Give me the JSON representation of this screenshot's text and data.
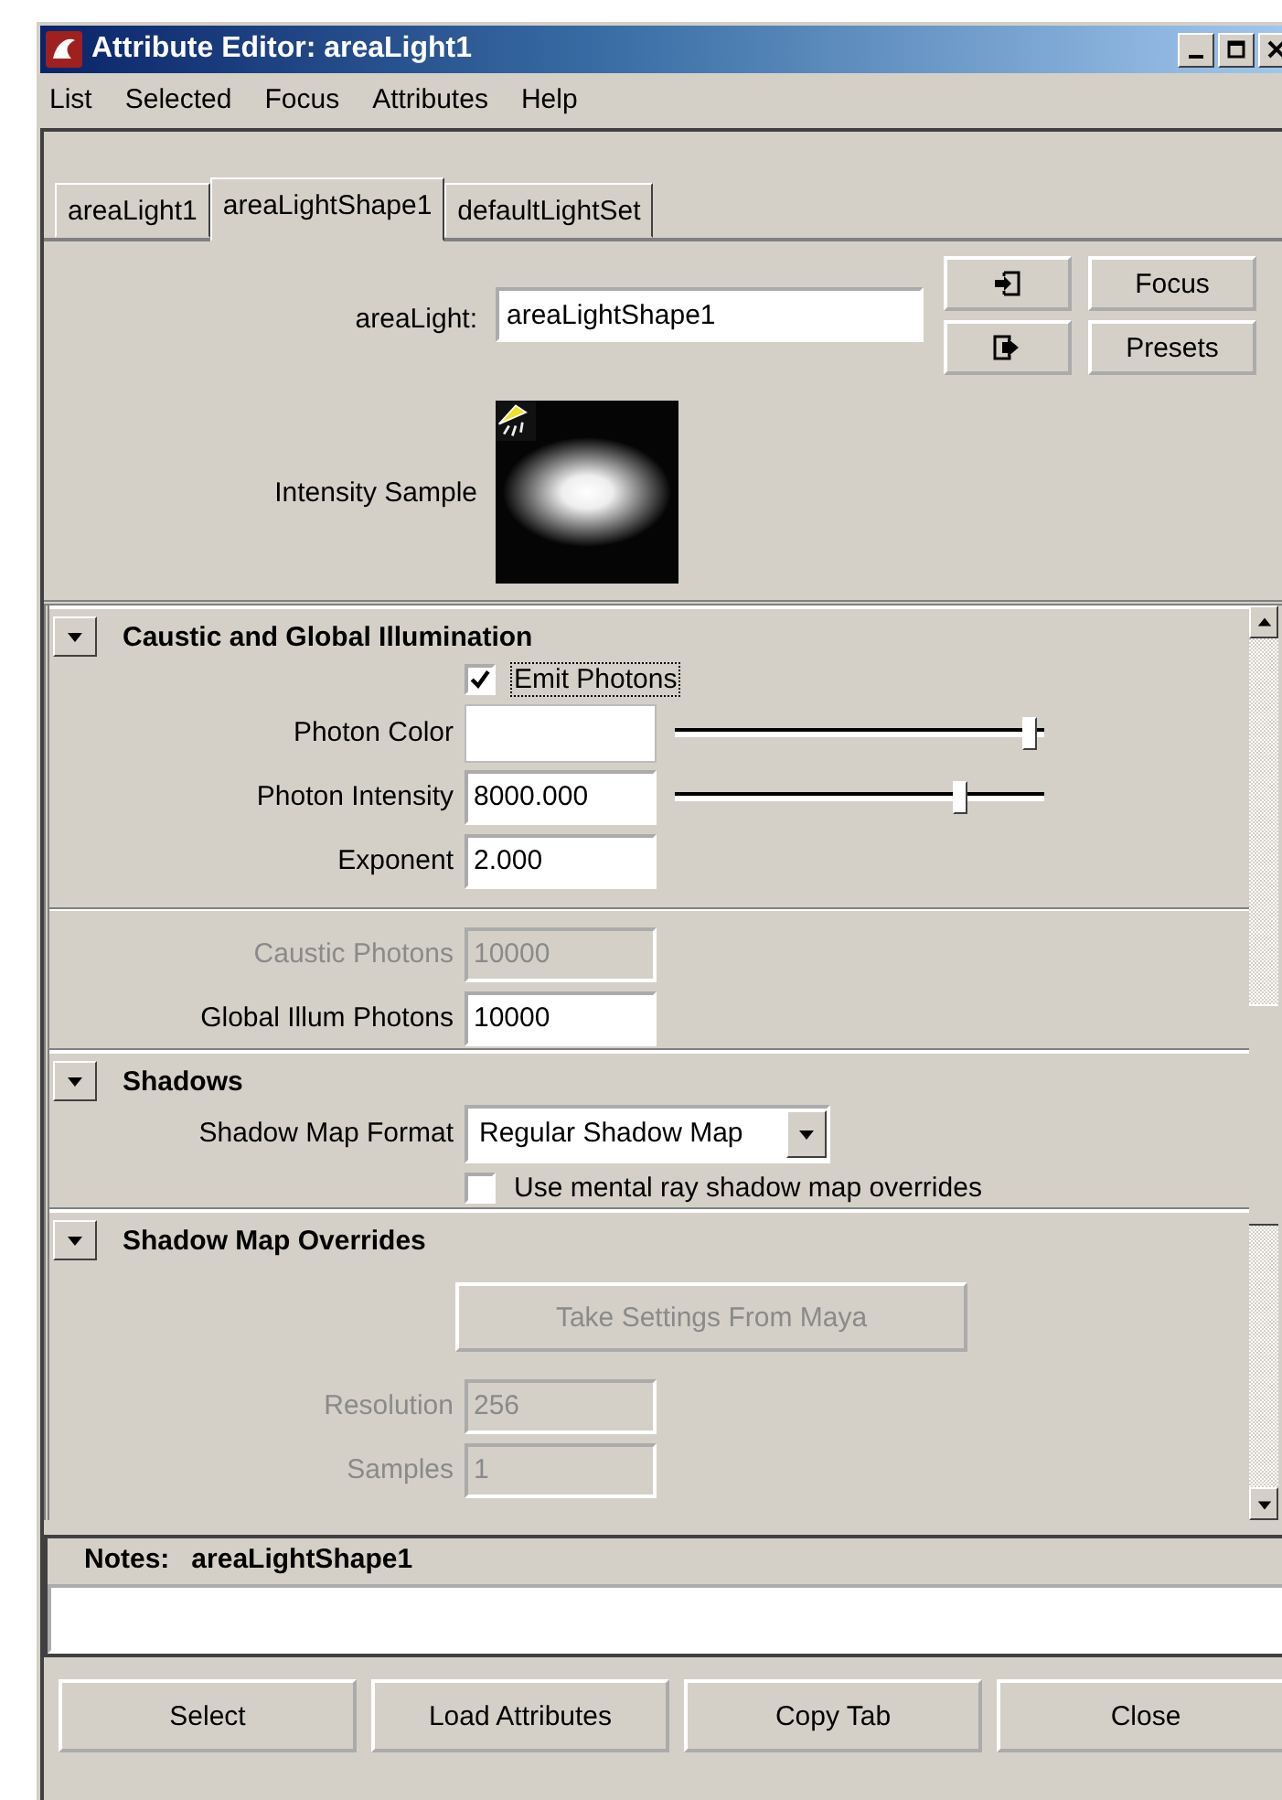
{
  "window": {
    "title": "Attribute Editor: areaLight1"
  },
  "menu": [
    "List",
    "Selected",
    "Focus",
    "Attributes",
    "Help"
  ],
  "tabs": [
    {
      "label": "areaLight1",
      "selected": false
    },
    {
      "label": "areaLightShape1",
      "selected": true
    },
    {
      "label": "defaultLightSet",
      "selected": false
    }
  ],
  "node": {
    "label": "areaLight:",
    "value": "areaLightShape1"
  },
  "node_buttons": [
    "Focus",
    "Presets"
  ],
  "sample": {
    "label": "Intensity Sample"
  },
  "sections": [
    {
      "title": "Caustic and Global Illumination",
      "expanded": true,
      "rows": [
        {
          "kind": "checkbox",
          "label": "Emit Photons",
          "checked": true
        },
        {
          "kind": "color",
          "label": "Photon Color",
          "color": "#ffffff",
          "level": 0.97
        },
        {
          "kind": "float",
          "label": "Photon Intensity",
          "value": "8000.000",
          "level": 0.78
        },
        {
          "kind": "field",
          "label": "Exponent",
          "value": "2.000",
          "disabled": false
        },
        {
          "kind": "divider"
        },
        {
          "kind": "field",
          "label": "Caustic Photons",
          "value": "10000",
          "disabled": true
        },
        {
          "kind": "field",
          "label": "Global Illum Photons",
          "value": "10000",
          "disabled": false
        }
      ]
    },
    {
      "title": "Shadows",
      "expanded": true,
      "rows": [
        {
          "kind": "dropdown",
          "label": "Shadow Map Format",
          "value": "Regular Shadow Map"
        },
        {
          "kind": "checkbox",
          "label": "Use mental ray shadow map overrides",
          "checked": false
        }
      ]
    },
    {
      "title": "Shadow Map Overrides",
      "expanded": true,
      "rows": [
        {
          "kind": "button",
          "label": "Take Settings From Maya",
          "disabled": true
        },
        {
          "kind": "field",
          "label": "Resolution",
          "value": "256",
          "disabled": true
        },
        {
          "kind": "field",
          "label": "Samples",
          "value": "1",
          "disabled": true
        }
      ]
    }
  ],
  "notes": {
    "label": "Notes:",
    "node": "areaLightShape1"
  },
  "buttons": [
    "Select",
    "Load Attributes",
    "Copy Tab",
    "Close"
  ]
}
